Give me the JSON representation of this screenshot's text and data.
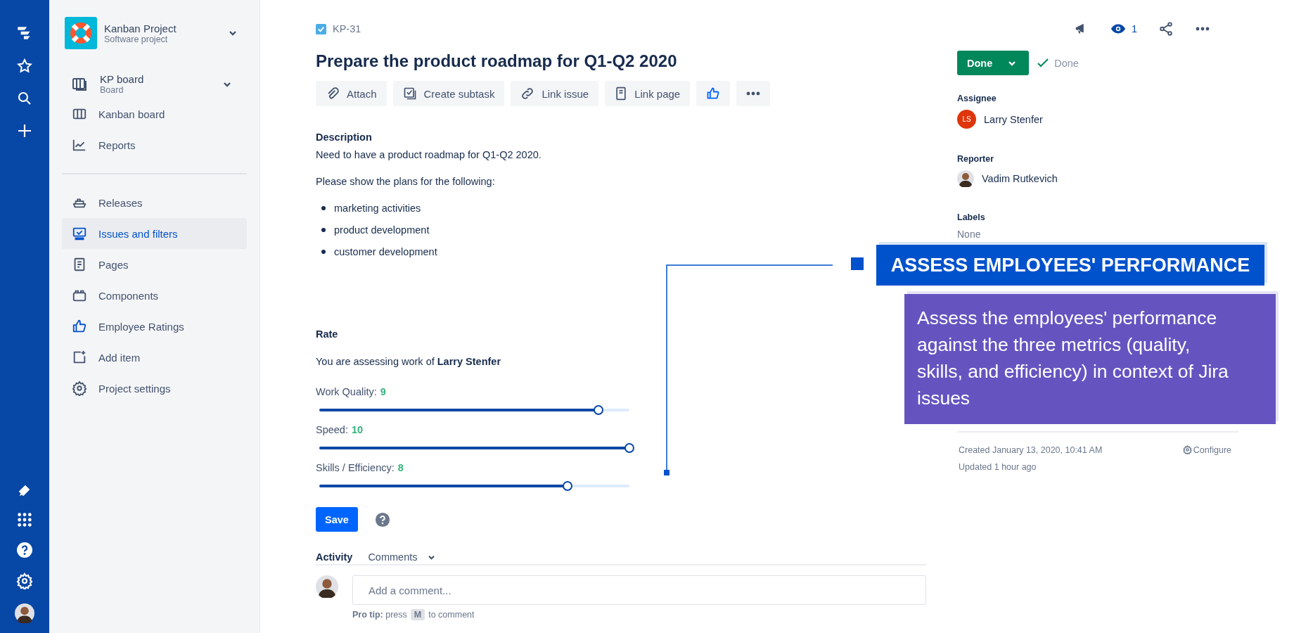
{
  "sidebar": {
    "project": {
      "name": "Kanban Project",
      "type": "Software project"
    },
    "board": {
      "name": "KP board",
      "type": "Board"
    },
    "sections": [
      {
        "items": [
          {
            "kind": "columns",
            "label": "Kanban board",
            "selected": false
          },
          {
            "kind": "reports",
            "label": "Reports",
            "selected": false
          }
        ]
      },
      {
        "items": [
          {
            "kind": "releases",
            "label": "Releases",
            "selected": false
          },
          {
            "kind": "issues",
            "label": "Issues and filters",
            "selected": true
          },
          {
            "kind": "pages",
            "label": "Pages",
            "selected": false
          },
          {
            "kind": "components",
            "label": "Components",
            "selected": false
          },
          {
            "kind": "ratings",
            "label": "Employee Ratings",
            "selected": false
          },
          {
            "kind": "add",
            "label": "Add item",
            "selected": false
          },
          {
            "kind": "settings",
            "label": "Project settings",
            "selected": false
          }
        ]
      }
    ]
  },
  "issue": {
    "key": "KP-31",
    "title": "Prepare the product roadmap for Q1-Q2 2020",
    "actions": [
      {
        "kind": "attach",
        "label": "Attach"
      },
      {
        "kind": "subtask",
        "label": "Create subtask"
      },
      {
        "kind": "link",
        "label": "Link issue"
      },
      {
        "kind": "page",
        "label": "Link page"
      },
      {
        "kind": "like"
      },
      {
        "kind": "more"
      }
    ]
  },
  "description": {
    "heading": "Description",
    "paragraphs": [
      "Need to have a product roadmap for Q1-Q2 2020.",
      "Please show the plans for the following:"
    ],
    "bullets": [
      "marketing activities",
      "product development",
      "customer development"
    ]
  },
  "rate": {
    "heading": "Rate",
    "intro": "You are assessing work of **Larry Stenfer**",
    "sliders": [
      {
        "label": "Work Quality:",
        "value": "9",
        "level": 0.9
      },
      {
        "label": "Speed:",
        "value": "10",
        "level": 1.0
      },
      {
        "label": "Skills / Efficiency:",
        "value": "8",
        "level": 0.8
      }
    ],
    "save": "Save"
  },
  "activity": {
    "heading": "Activity",
    "filter": "Comments"
  },
  "comment": {
    "placeholder": "Add a comment...",
    "tip": "**Pro tip:** press",
    "key": "M",
    "tip_end": "to comment"
  },
  "header": {
    "watchers": "1"
  },
  "status": {
    "button": "Done",
    "resolution": "Done"
  },
  "fields": [
    {
      "label": "Assignee",
      "value": "Larry Stenfer",
      "kind": "initials",
      "initials": "LS"
    },
    {
      "label": "Reporter",
      "value": "Vadim Rutkevich",
      "kind": "person"
    },
    {
      "label": "Labels",
      "value": "None",
      "kind": "empty"
    }
  ],
  "meta": {
    "created": "Created January 13, 2020, 10:41 AM",
    "updated": "Updated 1 hour ago",
    "configure": "Configure"
  },
  "callout": {
    "title": "ASSESS EMPLOYEES' PERFORMANCE",
    "text": "Assess the employees' performance against the three metrics (quality, skills, and efficiency) in context of Jira issues"
  }
}
